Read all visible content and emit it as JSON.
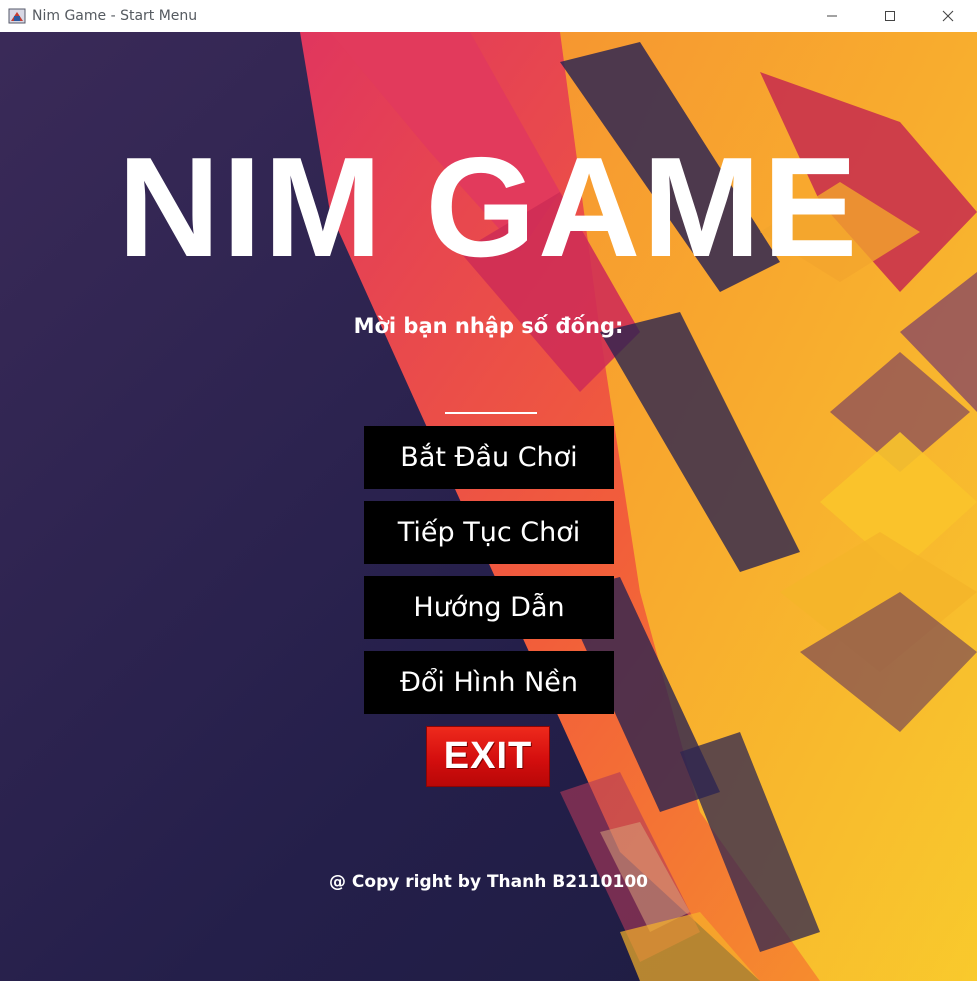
{
  "window": {
    "title": "Nim Game - Start Menu",
    "controls": [
      "minimize",
      "maximize",
      "close"
    ]
  },
  "game": {
    "title": "NIM GAME",
    "prompt": "Mời bạn nhập số đống:",
    "pile_input_value": ""
  },
  "menu": {
    "start_label": "Bắt Đầu Chơi",
    "continue_label": "Tiếp Tục Chơi",
    "guide_label": "Hướng Dẫn",
    "background_label": "Đổi Hình Nền",
    "exit_label": "EXIT"
  },
  "footer": {
    "copyright": "@ Copy right by Thanh B2110100"
  },
  "colors": {
    "button_bg": "#000000",
    "exit_red": "#d40e0e",
    "bg_dark": "#2a234f",
    "accent_orange": "#f47a2c",
    "accent_yellow": "#f9c42b"
  }
}
